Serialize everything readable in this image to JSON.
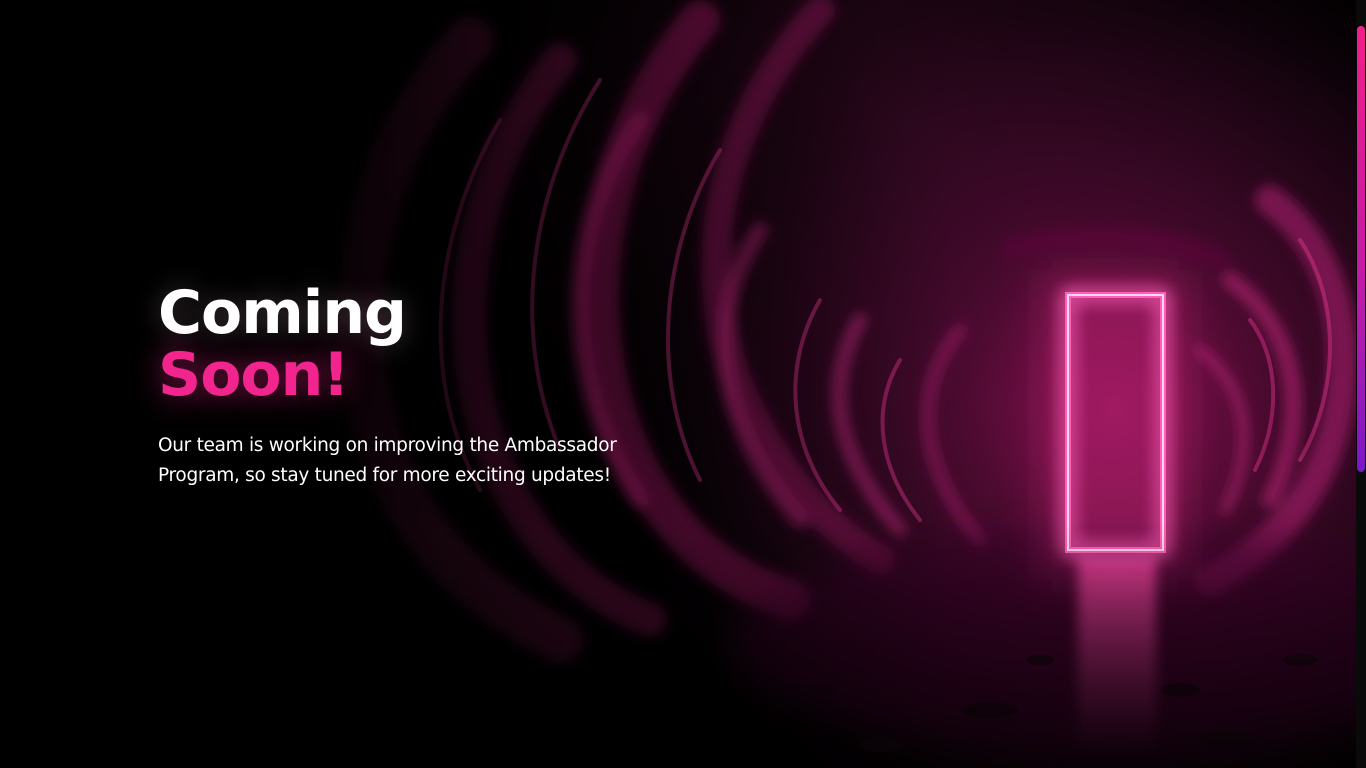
{
  "hero": {
    "title_line1": "Coming",
    "title_line2": "Soon!",
    "subtitle": "Our team is working on improving the Ambassador Program, so stay tuned for more exciting updates!"
  },
  "colors": {
    "background": "#000000",
    "accent": "#f2258e",
    "neon": "#ff5fb8",
    "text": "#ffffff"
  },
  "icons": {
    "door": "neon-door-icon"
  }
}
